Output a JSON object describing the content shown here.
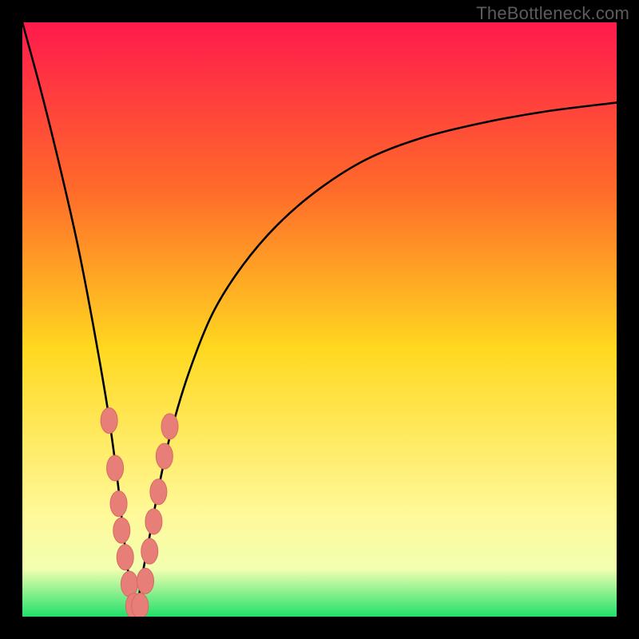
{
  "watermark": "TheBottleneck.com",
  "colors": {
    "frame": "#000000",
    "grad_top": "#ff1a4d",
    "grad_mid_upper": "#ff6a2a",
    "grad_mid": "#ffd820",
    "grad_lower": "#fff99a",
    "grad_bottom": "#21e06b",
    "curve": "#000000",
    "marker_fill": "#e77f78",
    "marker_stroke": "#d66a63"
  },
  "chart_data": {
    "type": "line",
    "title": "",
    "xlabel": "",
    "ylabel": "",
    "xlim": [
      0,
      100
    ],
    "ylim": [
      0,
      100
    ],
    "note": "V-shaped bottleneck curve. x is a balance/ratio axis; y is bottleneck severity (0 = no bottleneck at optimum, rising toward 100 away from it). Optimum near x≈19. Values estimated from pixel positions; no numeric axis labels are shown.",
    "series": [
      {
        "name": "bottleneck-curve",
        "x": [
          0,
          3,
          6,
          9,
          11,
          13,
          14.5,
          16,
          17,
          18,
          19,
          20,
          21.5,
          23,
          25,
          28,
          32,
          37,
          43,
          50,
          58,
          67,
          77,
          88,
          100
        ],
        "y": [
          100,
          89,
          77,
          64,
          54,
          43,
          34,
          23,
          14,
          6,
          0,
          6,
          14,
          22,
          31,
          41,
          51,
          59,
          66,
          72,
          77,
          80.5,
          83,
          85,
          86.5
        ]
      }
    ],
    "markers": {
      "name": "highlighted-points",
      "note": "Salmon elliptical markers clustered near the curve minimum on both branches.",
      "points": [
        {
          "x": 14.6,
          "y": 33
        },
        {
          "x": 15.6,
          "y": 25
        },
        {
          "x": 16.2,
          "y": 19
        },
        {
          "x": 16.7,
          "y": 14.5
        },
        {
          "x": 17.3,
          "y": 10
        },
        {
          "x": 18.0,
          "y": 5.5
        },
        {
          "x": 18.8,
          "y": 1.8
        },
        {
          "x": 19.8,
          "y": 1.8
        },
        {
          "x": 20.7,
          "y": 6
        },
        {
          "x": 21.4,
          "y": 11
        },
        {
          "x": 22.1,
          "y": 16
        },
        {
          "x": 22.9,
          "y": 21
        },
        {
          "x": 23.9,
          "y": 27
        },
        {
          "x": 24.8,
          "y": 32
        }
      ]
    }
  }
}
